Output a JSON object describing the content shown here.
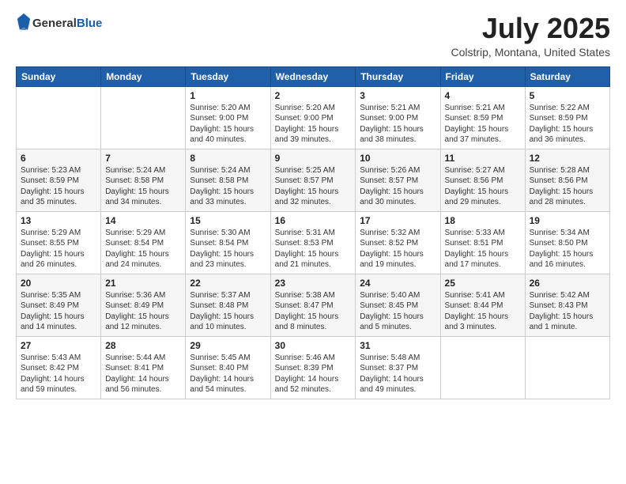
{
  "header": {
    "logo": {
      "line1": "General",
      "line2": "Blue"
    },
    "title": "July 2025",
    "location": "Colstrip, Montana, United States"
  },
  "weekdays": [
    "Sunday",
    "Monday",
    "Tuesday",
    "Wednesday",
    "Thursday",
    "Friday",
    "Saturday"
  ],
  "weeks": [
    [
      {
        "day": "",
        "content": ""
      },
      {
        "day": "",
        "content": ""
      },
      {
        "day": "1",
        "content": "Sunrise: 5:20 AM\nSunset: 9:00 PM\nDaylight: 15 hours and 40 minutes."
      },
      {
        "day": "2",
        "content": "Sunrise: 5:20 AM\nSunset: 9:00 PM\nDaylight: 15 hours and 39 minutes."
      },
      {
        "day": "3",
        "content": "Sunrise: 5:21 AM\nSunset: 9:00 PM\nDaylight: 15 hours and 38 minutes."
      },
      {
        "day": "4",
        "content": "Sunrise: 5:21 AM\nSunset: 8:59 PM\nDaylight: 15 hours and 37 minutes."
      },
      {
        "day": "5",
        "content": "Sunrise: 5:22 AM\nSunset: 8:59 PM\nDaylight: 15 hours and 36 minutes."
      }
    ],
    [
      {
        "day": "6",
        "content": "Sunrise: 5:23 AM\nSunset: 8:59 PM\nDaylight: 15 hours and 35 minutes."
      },
      {
        "day": "7",
        "content": "Sunrise: 5:24 AM\nSunset: 8:58 PM\nDaylight: 15 hours and 34 minutes."
      },
      {
        "day": "8",
        "content": "Sunrise: 5:24 AM\nSunset: 8:58 PM\nDaylight: 15 hours and 33 minutes."
      },
      {
        "day": "9",
        "content": "Sunrise: 5:25 AM\nSunset: 8:57 PM\nDaylight: 15 hours and 32 minutes."
      },
      {
        "day": "10",
        "content": "Sunrise: 5:26 AM\nSunset: 8:57 PM\nDaylight: 15 hours and 30 minutes."
      },
      {
        "day": "11",
        "content": "Sunrise: 5:27 AM\nSunset: 8:56 PM\nDaylight: 15 hours and 29 minutes."
      },
      {
        "day": "12",
        "content": "Sunrise: 5:28 AM\nSunset: 8:56 PM\nDaylight: 15 hours and 28 minutes."
      }
    ],
    [
      {
        "day": "13",
        "content": "Sunrise: 5:29 AM\nSunset: 8:55 PM\nDaylight: 15 hours and 26 minutes."
      },
      {
        "day": "14",
        "content": "Sunrise: 5:29 AM\nSunset: 8:54 PM\nDaylight: 15 hours and 24 minutes."
      },
      {
        "day": "15",
        "content": "Sunrise: 5:30 AM\nSunset: 8:54 PM\nDaylight: 15 hours and 23 minutes."
      },
      {
        "day": "16",
        "content": "Sunrise: 5:31 AM\nSunset: 8:53 PM\nDaylight: 15 hours and 21 minutes."
      },
      {
        "day": "17",
        "content": "Sunrise: 5:32 AM\nSunset: 8:52 PM\nDaylight: 15 hours and 19 minutes."
      },
      {
        "day": "18",
        "content": "Sunrise: 5:33 AM\nSunset: 8:51 PM\nDaylight: 15 hours and 17 minutes."
      },
      {
        "day": "19",
        "content": "Sunrise: 5:34 AM\nSunset: 8:50 PM\nDaylight: 15 hours and 16 minutes."
      }
    ],
    [
      {
        "day": "20",
        "content": "Sunrise: 5:35 AM\nSunset: 8:49 PM\nDaylight: 15 hours and 14 minutes."
      },
      {
        "day": "21",
        "content": "Sunrise: 5:36 AM\nSunset: 8:49 PM\nDaylight: 15 hours and 12 minutes."
      },
      {
        "day": "22",
        "content": "Sunrise: 5:37 AM\nSunset: 8:48 PM\nDaylight: 15 hours and 10 minutes."
      },
      {
        "day": "23",
        "content": "Sunrise: 5:38 AM\nSunset: 8:47 PM\nDaylight: 15 hours and 8 minutes."
      },
      {
        "day": "24",
        "content": "Sunrise: 5:40 AM\nSunset: 8:45 PM\nDaylight: 15 hours and 5 minutes."
      },
      {
        "day": "25",
        "content": "Sunrise: 5:41 AM\nSunset: 8:44 PM\nDaylight: 15 hours and 3 minutes."
      },
      {
        "day": "26",
        "content": "Sunrise: 5:42 AM\nSunset: 8:43 PM\nDaylight: 15 hours and 1 minute."
      }
    ],
    [
      {
        "day": "27",
        "content": "Sunrise: 5:43 AM\nSunset: 8:42 PM\nDaylight: 14 hours and 59 minutes."
      },
      {
        "day": "28",
        "content": "Sunrise: 5:44 AM\nSunset: 8:41 PM\nDaylight: 14 hours and 56 minutes."
      },
      {
        "day": "29",
        "content": "Sunrise: 5:45 AM\nSunset: 8:40 PM\nDaylight: 14 hours and 54 minutes."
      },
      {
        "day": "30",
        "content": "Sunrise: 5:46 AM\nSunset: 8:39 PM\nDaylight: 14 hours and 52 minutes."
      },
      {
        "day": "31",
        "content": "Sunrise: 5:48 AM\nSunset: 8:37 PM\nDaylight: 14 hours and 49 minutes."
      },
      {
        "day": "",
        "content": ""
      },
      {
        "day": "",
        "content": ""
      }
    ]
  ]
}
